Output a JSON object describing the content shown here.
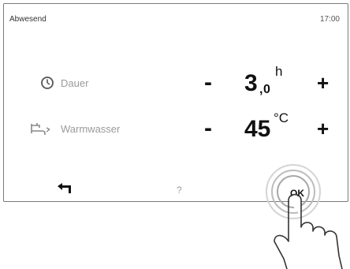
{
  "header": {
    "title": "Abwesend",
    "time": "17:00"
  },
  "rows": [
    {
      "label": "Dauer",
      "icon": "clock-icon",
      "decrement_label": "-",
      "increment_label": "+",
      "value_integer": "3",
      "value_separator": ",",
      "value_decimal": "0",
      "unit": "h"
    },
    {
      "label": "Warmwasser",
      "icon": "faucet-icon",
      "decrement_label": "-",
      "increment_label": "+",
      "value_integer": "45",
      "unit": "°C"
    }
  ],
  "footer": {
    "back_icon": "back-arrow-icon",
    "help_label": "?",
    "ok_label": "OK"
  },
  "overlay": {
    "icon": "tapping-hand-icon"
  },
  "colors": {
    "border": "#7a7a7a",
    "text": "#111111",
    "muted": "#9a9a9a",
    "ring": "#bdbdbd"
  }
}
